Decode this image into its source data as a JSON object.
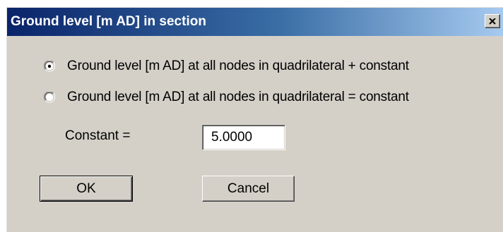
{
  "window": {
    "title": "Ground level [m AD] in section",
    "close_icon": "close-icon"
  },
  "options": [
    {
      "label": "Ground level [m AD] at all nodes in quadrilateral + constant",
      "selected": true
    },
    {
      "label": "Ground level [m AD] at all nodes in quadrilateral = constant",
      "selected": false
    }
  ],
  "constant": {
    "label": "Constant =",
    "value": "5.0000"
  },
  "buttons": {
    "ok_label": "OK",
    "cancel_label": "Cancel"
  },
  "colors": {
    "dialog_bg": "#d4d0c8",
    "title_start": "#0a246a",
    "title_end": "#a6caf0"
  }
}
